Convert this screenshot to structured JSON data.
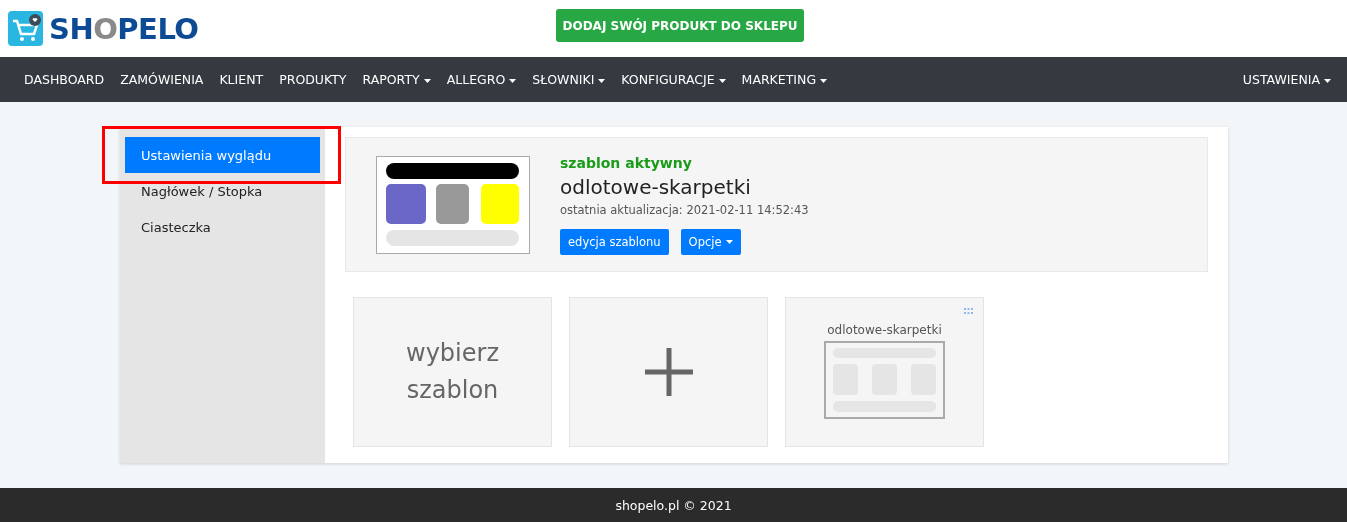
{
  "logo": {
    "parts": [
      {
        "text": "SH",
        "accent": false
      },
      {
        "text": "O",
        "accent": true
      },
      {
        "text": "PELO",
        "accent": false
      }
    ]
  },
  "add_product_button": "DODAJ SWÓJ PRODUKT DO SKLEPU",
  "nav": {
    "items": [
      {
        "label": "DASHBOARD",
        "dropdown": false
      },
      {
        "label": "ZAMÓWIENIA",
        "dropdown": false
      },
      {
        "label": "KLIENT",
        "dropdown": false
      },
      {
        "label": "PRODUKTY",
        "dropdown": false
      },
      {
        "label": "RAPORTY",
        "dropdown": true
      },
      {
        "label": "ALLEGRO",
        "dropdown": true
      },
      {
        "label": "SŁOWNIKI",
        "dropdown": true
      },
      {
        "label": "KONFIGURACJE",
        "dropdown": true
      },
      {
        "label": "MARKETING",
        "dropdown": true
      }
    ],
    "right": {
      "label": "USTAWIENIA",
      "dropdown": true
    }
  },
  "sidebar": {
    "items": [
      {
        "label": "Ustawienia wyglądu",
        "selected": true,
        "highlighted": true
      },
      {
        "label": "Nagłówek / Stopka",
        "selected": false,
        "highlighted": false
      },
      {
        "label": "Ciasteczka",
        "selected": false,
        "highlighted": false
      }
    ]
  },
  "active_template": {
    "status": "szablon aktywny",
    "name": "odlotowe-skarpetki",
    "updated": "ostatnia aktualizacja: 2021-02-11 14:52:43",
    "buttons": [
      {
        "label": "edycja szablonu",
        "dropdown": false
      },
      {
        "label": "Opcje",
        "dropdown": true
      }
    ]
  },
  "tiles": [
    {
      "kind": "text",
      "label": "wybierz szablon"
    },
    {
      "kind": "add"
    },
    {
      "kind": "template",
      "label": "odlotowe-skarpetki"
    }
  ],
  "footer": "shopelo.pl © 2021"
}
